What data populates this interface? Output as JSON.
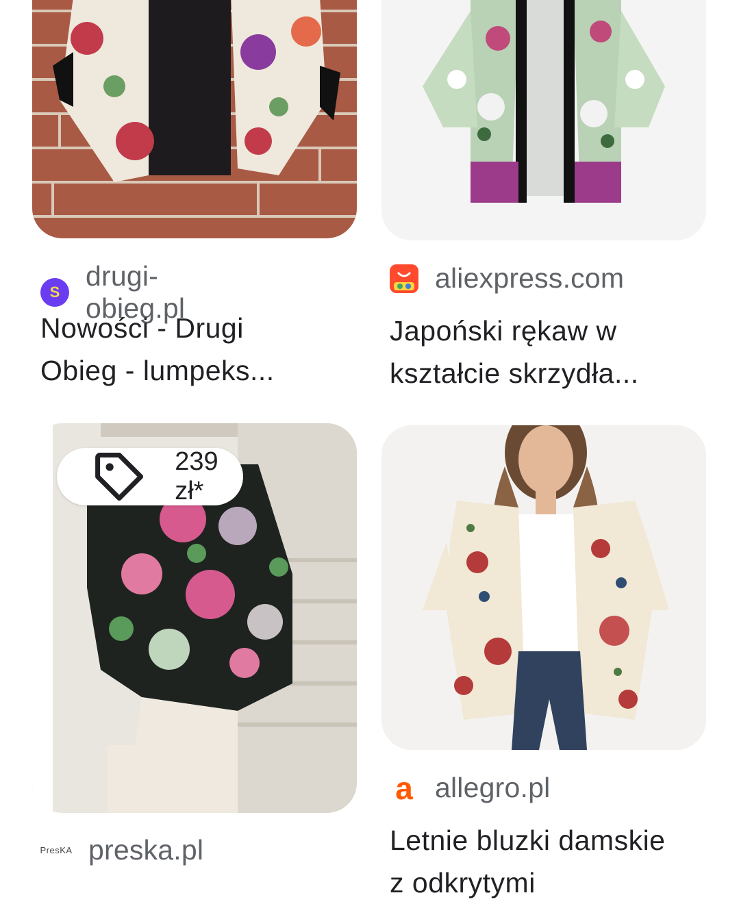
{
  "results": [
    {
      "domain": "drugi-obieg.pl",
      "favicon_text": "S",
      "favicon_color": "#6a3df0",
      "title_line1": "Nowości - Drugi",
      "title_line2": "Obieg - lumpeks..."
    },
    {
      "domain": "aliexpress.com",
      "favicon_color": "#ff4a2e",
      "title_line1": "Japoński rękaw w",
      "title_line2": "kształcie skrzydła..."
    },
    {
      "domain": "preska.pl",
      "favicon_text": "PresKA",
      "price": "239 zł*",
      "price_icon": "tag-icon"
    },
    {
      "domain": "allegro.pl",
      "favicon_text": "a",
      "favicon_color": "#ff5a00",
      "title_line1": "Letnie bluzki damskie",
      "title_line2": "z odkrytymi"
    }
  ]
}
